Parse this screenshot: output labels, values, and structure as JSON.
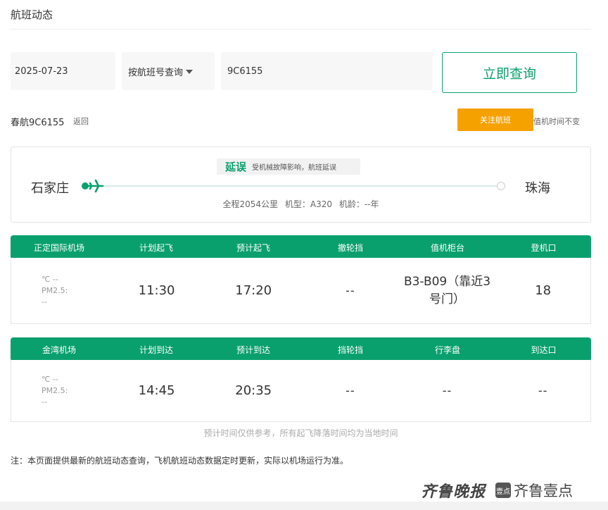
{
  "page": {
    "title": "航班动态"
  },
  "search": {
    "date": "2025-07-23",
    "query_type": "按航班号查询",
    "flight_no": "9C6155",
    "submit_label": "立即查询"
  },
  "flight": {
    "label": "春航9C6155",
    "back_label": "返回",
    "follow_label": "关注航班",
    "checkin_note": "值机时间不变"
  },
  "route": {
    "status": "延误",
    "status_reason": "受机械故障影响，航班延误",
    "origin": "石家庄",
    "destination": "珠海",
    "distance": "全程2054公里",
    "aircraft": "机型：A320",
    "age": "机龄：--年"
  },
  "departure": {
    "headers": [
      "正定国际机场",
      "计划起飞",
      "预计起飞",
      "撤轮挡",
      "值机柜台",
      "登机口"
    ],
    "temp": "℃ --",
    "pm_label": "PM2.5:",
    "pm_value": "--",
    "scheduled": "11:30",
    "estimated": "17:20",
    "chocks_off": "--",
    "counter": "B3-B09（靠近3号门）",
    "gate": "18"
  },
  "arrival": {
    "headers": [
      "金湾机场",
      "计划到达",
      "预计到达",
      "挡轮挡",
      "行李盘",
      "到达口"
    ],
    "temp": "℃ --",
    "pm_label": "PM2.5:",
    "pm_value": "--",
    "scheduled": "14:45",
    "estimated": "20:35",
    "chocks_on": "--",
    "baggage": "--",
    "exit": "--"
  },
  "notes": {
    "time_note": "预计时间仅供参考，所有起飞降落时间均为当地时间",
    "footnote": "注：本页面提供最新的航班动态查询，飞机航班动态数据定时更新，实际以机场运行为准。"
  },
  "watermark": {
    "qilu": "齐鲁晚报",
    "badge": "壹点",
    "yidian": "齐鲁壹点"
  },
  "colors": {
    "accent": "#0aa06e",
    "follow": "#f5a100"
  }
}
